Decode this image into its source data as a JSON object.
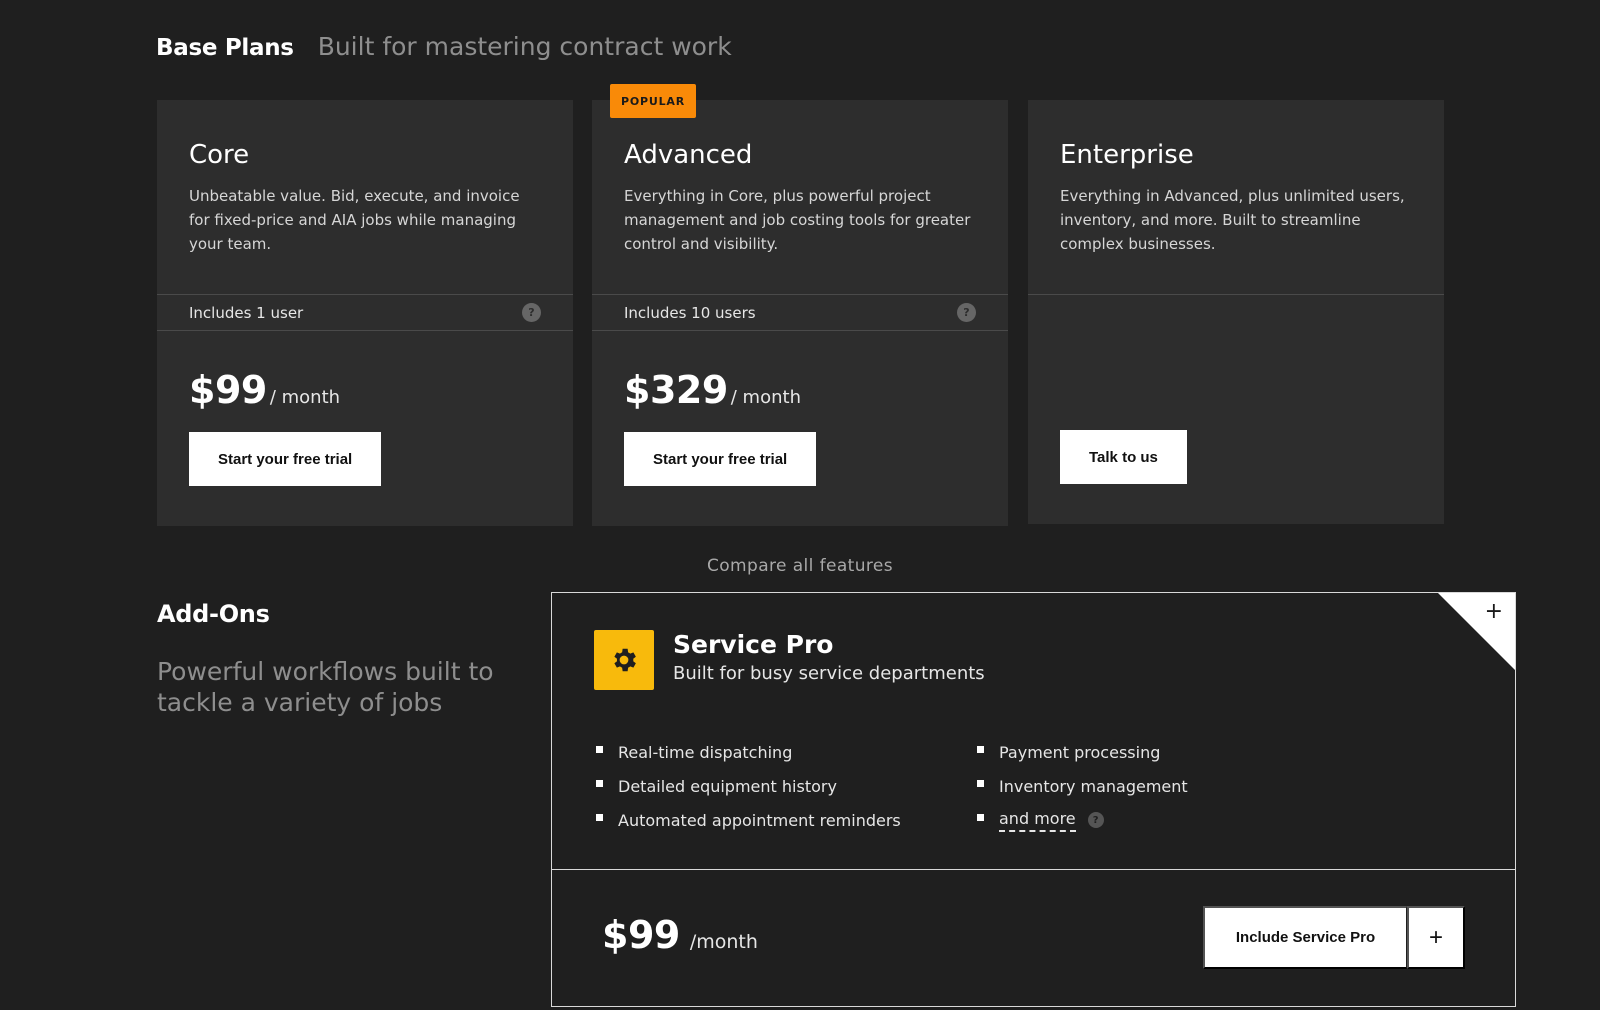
{
  "header": {
    "title": "Base Plans",
    "subtitle": "Built for mastering contract work"
  },
  "plans": [
    {
      "name": "Core",
      "description": "Unbeatable value. Bid, execute, and invoice for fixed-price and AIA jobs while managing your team.",
      "users": "Includes 1 user",
      "price": "$99",
      "period": "/ month",
      "cta": "Start your free trial"
    },
    {
      "name": "Advanced",
      "badge": "POPULAR",
      "description": "Everything in Core, plus powerful project management and job costing tools for greater control and visibility.",
      "users": "Includes 10 users",
      "price": "$329",
      "period": "/ month",
      "cta": "Start your free trial"
    },
    {
      "name": "Enterprise",
      "description": "Everything in Advanced, plus unlimited users, inventory, and more. Built to streamline complex businesses.",
      "cta": "Talk to us"
    }
  ],
  "help_glyph": "?",
  "compare_link": "Compare all features",
  "addons": {
    "title": "Add-Ons",
    "subtitle": "Powerful workflows built to tackle a variety of jobs",
    "service_pro": {
      "icon": "gear-icon",
      "name": "Service Pro",
      "tagline": "Built for busy service departments",
      "features_left": [
        "Real-time dispatching",
        "Detailed equipment history",
        "Automated appointment reminders"
      ],
      "features_right": [
        "Payment processing",
        "Inventory management"
      ],
      "more_link": "and more",
      "price": "$99",
      "period": "/month",
      "include_label": "Include Service Pro",
      "plus_glyph": "+"
    }
  },
  "colors": {
    "background": "#1f1f1f",
    "card": "#2d2d2d",
    "popular_badge": "#f98a08",
    "service_pro_icon": "#f8ba0c"
  }
}
